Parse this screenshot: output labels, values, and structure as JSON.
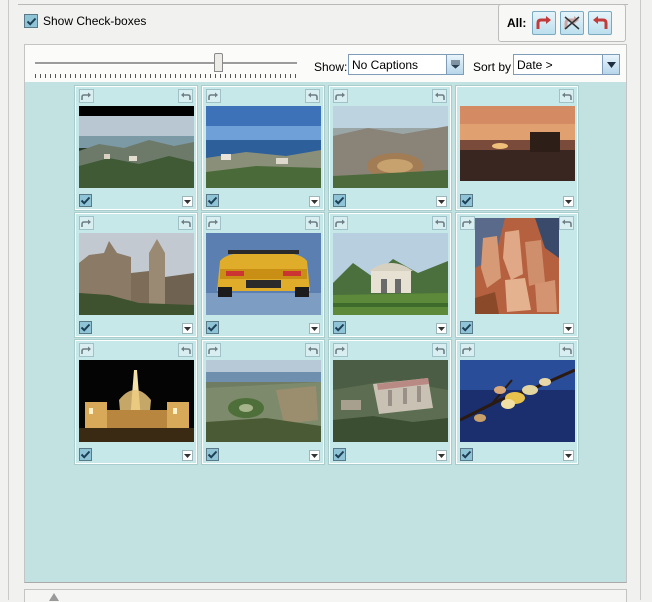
{
  "show_checkboxes": {
    "label": "Show Check-boxes",
    "checked": true
  },
  "all_actions": {
    "label": "All:",
    "buttons": [
      {
        "name": "rotate-right-all-button",
        "icon": "rotate-right-icon"
      },
      {
        "name": "clear-rotation-all-button",
        "icon": "clear-rotation-icon"
      },
      {
        "name": "rotate-left-all-button",
        "icon": "rotate-left-icon"
      }
    ]
  },
  "toolbar": {
    "zoom_level": 0.7,
    "show_label": "Show:",
    "show_value": "No Captions",
    "sort_label": "Sort by",
    "sort_value": "Date >"
  },
  "accent_color": "#c2e1e1",
  "photos": [
    {
      "subject": "harbor city view",
      "checked": true
    },
    {
      "subject": "port aerial view",
      "checked": true
    },
    {
      "subject": "bullring city view",
      "checked": true
    },
    {
      "subject": "sunset over water",
      "checked": true
    },
    {
      "subject": "cathedral",
      "checked": true
    },
    {
      "subject": "yellow sports car",
      "checked": true
    },
    {
      "subject": "park pavilion",
      "checked": true
    },
    {
      "subject": "cubist painting",
      "checked": true
    },
    {
      "subject": "illuminated fountain",
      "checked": true
    },
    {
      "subject": "gardens aerial view",
      "checked": true
    },
    {
      "subject": "city hall aerial view",
      "checked": true
    },
    {
      "subject": "magnolia blossoms",
      "checked": true
    }
  ]
}
